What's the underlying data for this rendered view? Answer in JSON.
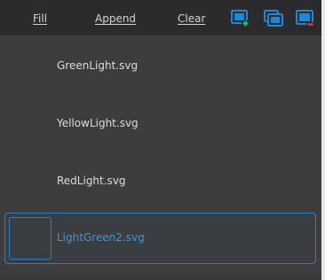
{
  "toolbar": {
    "fill_label": "Fill",
    "append_label": "Append",
    "clear_label": "Clear",
    "icons": [
      "add-image-icon",
      "duplicate-image-icon",
      "remove-image-icon"
    ],
    "accent_color": "#1e88d8",
    "add_color": "#2ec04a",
    "remove_color": "#e23b3b"
  },
  "list": {
    "items": [
      {
        "label": "GreenLight.svg",
        "selected": false
      },
      {
        "label": "YellowLight.svg",
        "selected": false
      },
      {
        "label": "RedLight.svg",
        "selected": false
      },
      {
        "label": "LightGreen2.svg",
        "selected": true
      }
    ],
    "selection_color": "#2e7fc0"
  }
}
